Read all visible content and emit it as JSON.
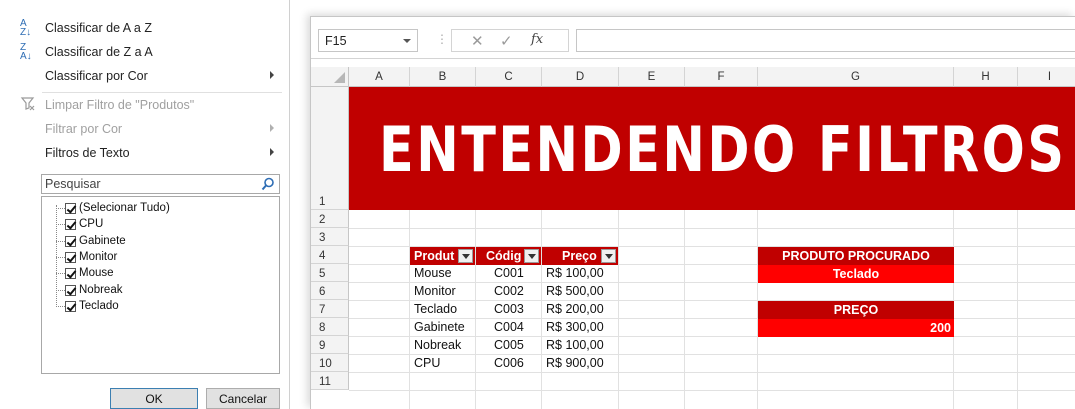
{
  "filter_menu": {
    "items": [
      {
        "label": "Classificar de A a Z",
        "icon": "sort-az-icon",
        "icon_text": "A\nZ",
        "submenu": false,
        "disabled": false
      },
      {
        "label": "Classificar de Z a A",
        "icon": "sort-za-icon",
        "icon_text": "Z\nA",
        "submenu": false,
        "disabled": false
      },
      {
        "label": "Classificar por Cor",
        "icon": "",
        "submenu": true,
        "disabled": false
      },
      {
        "label": "Limpar Filtro de \"Produtos\"",
        "icon": "clear-filter-icon",
        "submenu": false,
        "disabled": true
      },
      {
        "label": "Filtrar por Cor",
        "icon": "",
        "submenu": true,
        "disabled": true
      },
      {
        "label": "Filtros de Texto",
        "icon": "",
        "submenu": true,
        "disabled": false
      }
    ],
    "search": {
      "placeholder": "Pesquisar",
      "value": ""
    },
    "checklist": [
      {
        "label": "(Selecionar Tudo)",
        "checked": true
      },
      {
        "label": "CPU",
        "checked": true
      },
      {
        "label": "Gabinete",
        "checked": true
      },
      {
        "label": "Monitor",
        "checked": true
      },
      {
        "label": "Mouse",
        "checked": true
      },
      {
        "label": "Nobreak",
        "checked": true
      },
      {
        "label": "Teclado",
        "checked": true
      }
    ],
    "ok_label": "OK",
    "cancel_label": "Cancelar"
  },
  "excel": {
    "name_box": "F15",
    "formula_fx": "fx",
    "formula_value": "",
    "columns": [
      "A",
      "B",
      "C",
      "D",
      "E",
      "F",
      "G",
      "H",
      "I"
    ],
    "rows": [
      "1",
      "2",
      "3",
      "4",
      "5",
      "6",
      "7",
      "8",
      "9",
      "10",
      "11"
    ],
    "banner_title": "ENTENDENDO FILTROS",
    "table": {
      "headers": [
        "Produt",
        "Códig",
        "Preço"
      ],
      "rows": [
        [
          "Mouse",
          "C001",
          "R$ 100,00"
        ],
        [
          "Monitor",
          "C002",
          "R$ 500,00"
        ],
        [
          "Teclado",
          "C003",
          "R$ 200,00"
        ],
        [
          "Gabinete",
          "C004",
          "R$ 300,00"
        ],
        [
          "Nobreak",
          "C005",
          "R$ 100,00"
        ],
        [
          "CPU",
          "C006",
          "R$ 900,00"
        ]
      ]
    },
    "produto_procurado_label": "PRODUTO  PROCURADO",
    "produto_procurado_value": "Teclado",
    "preco_label": "PREÇO",
    "preco_value": "200",
    "colors": {
      "banner": "#c00000",
      "bright_red": "#ff0000",
      "dark_red": "#c00000"
    }
  }
}
